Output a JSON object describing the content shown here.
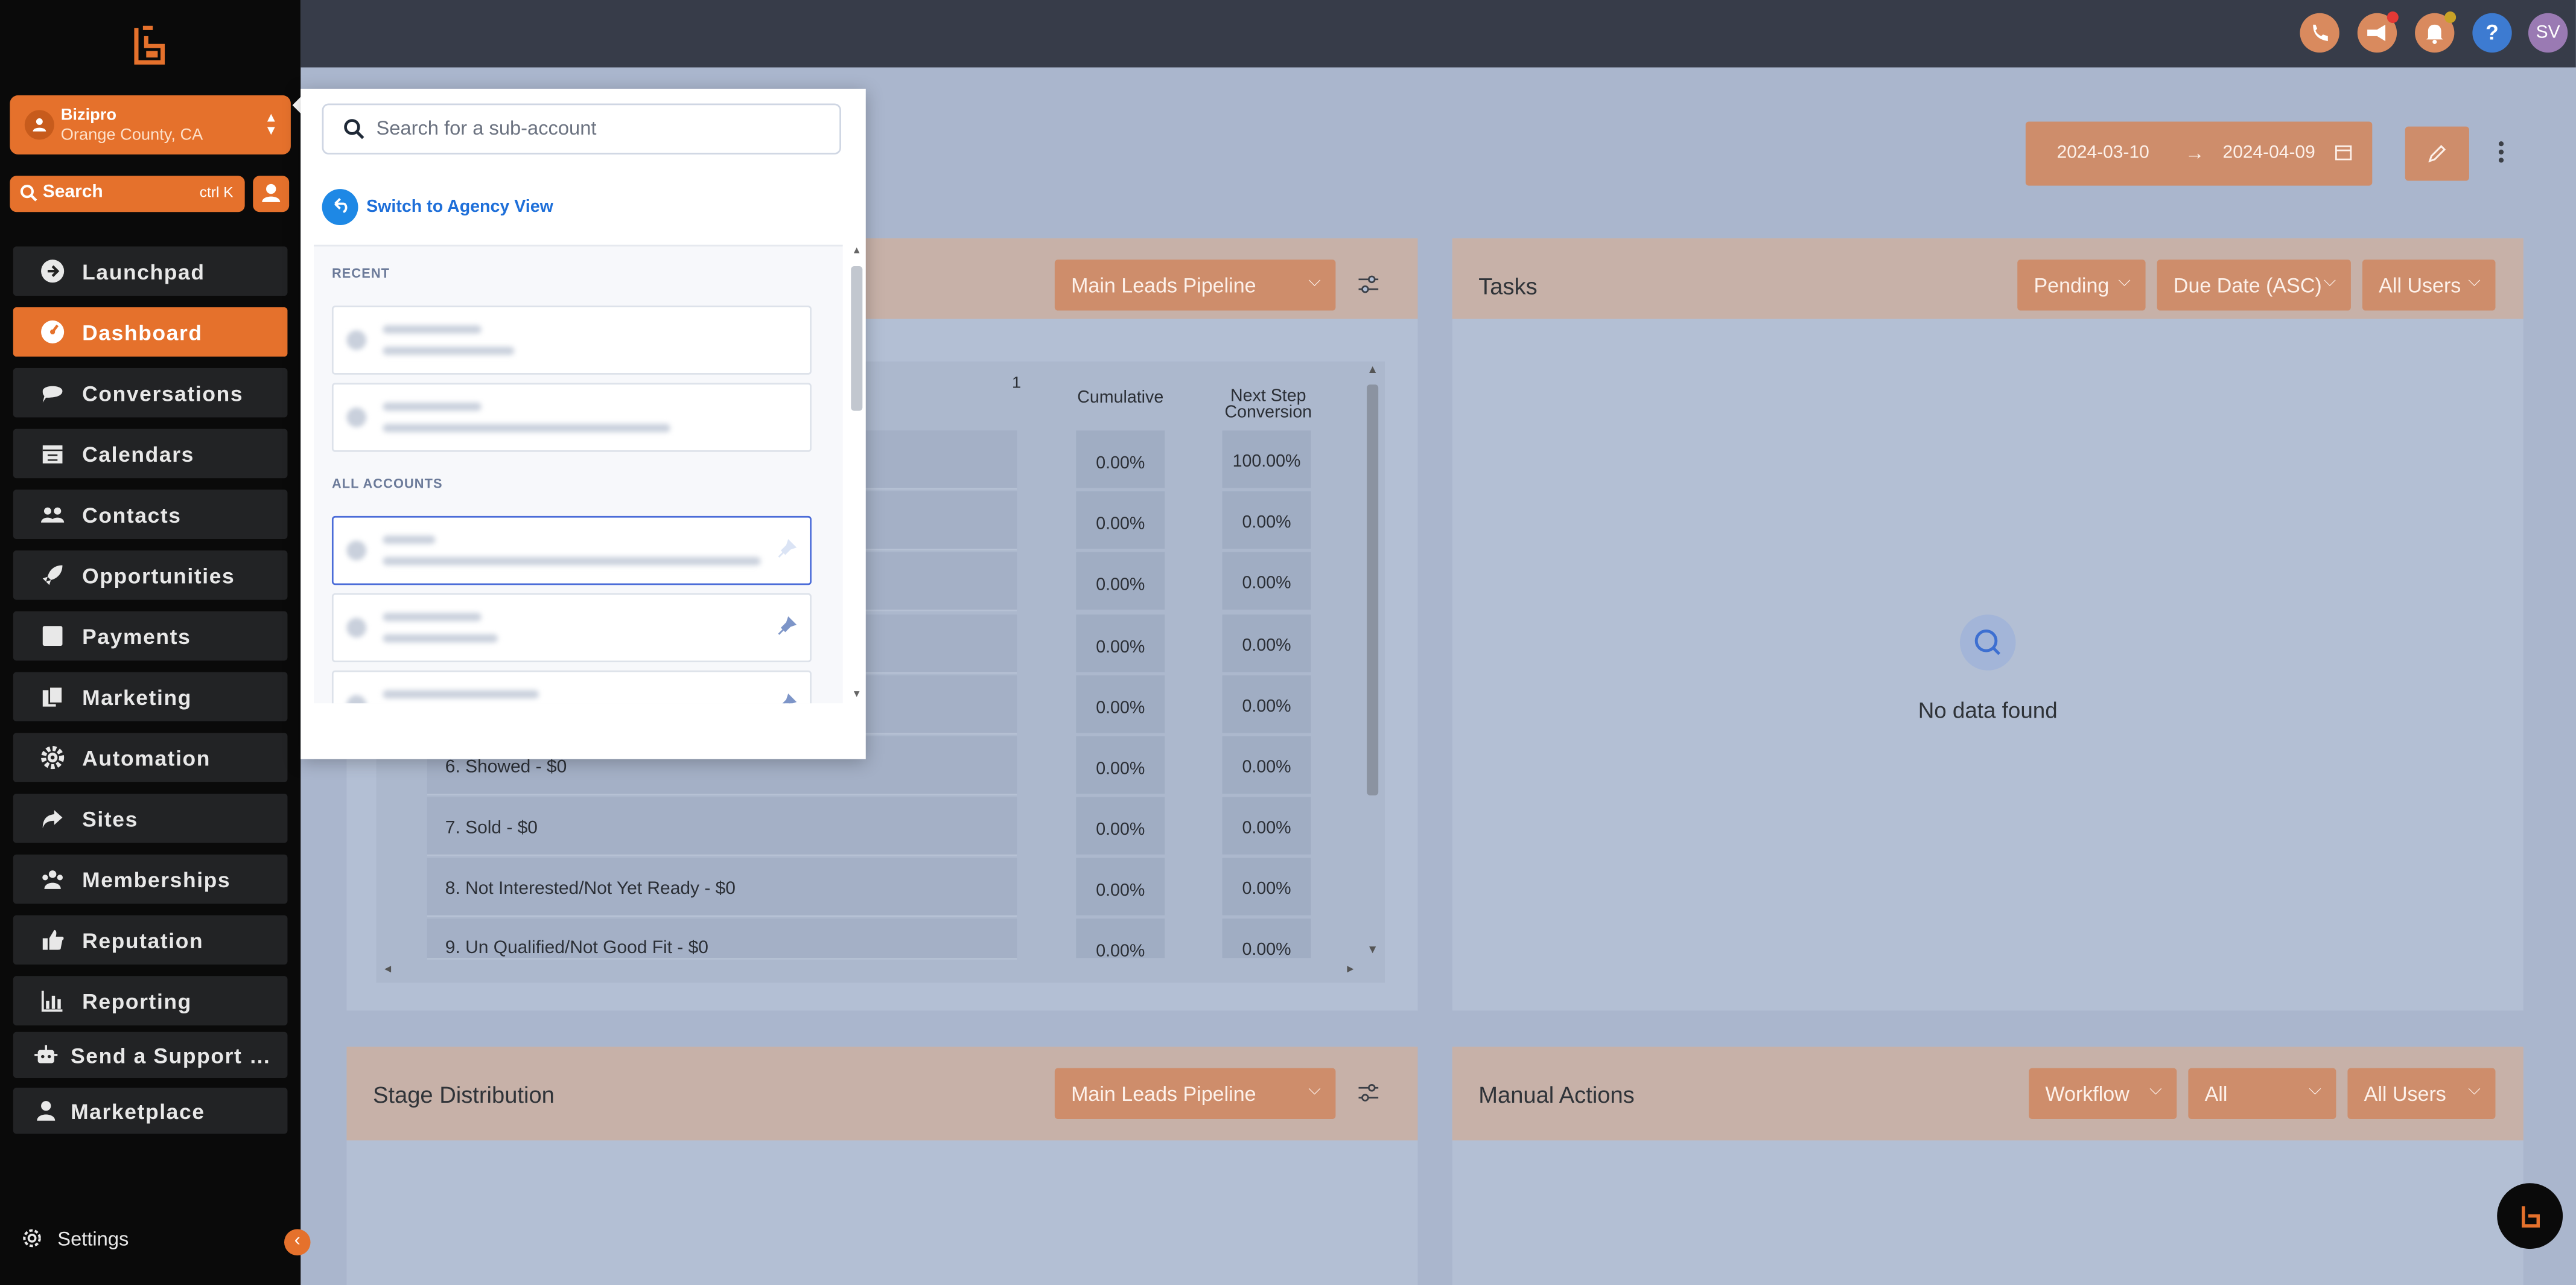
{
  "colors": {
    "accent": "#e5712c",
    "sidebar": "#0a0a0a",
    "topbar": "#373c49",
    "link_blue": "#1e6fd9"
  },
  "sidebar": {
    "account": {
      "name": "Bizipro",
      "location": "Orange County, CA"
    },
    "search": {
      "label": "Search",
      "shortcut": "ctrl K"
    },
    "items": [
      {
        "label": "Launchpad",
        "icon": "launchpad-icon"
      },
      {
        "label": "Dashboard",
        "icon": "dashboard-icon",
        "active": true
      },
      {
        "label": "Conversations",
        "icon": "chat-bubble-icon"
      },
      {
        "label": "Calendars",
        "icon": "calendar-icon"
      },
      {
        "label": "Contacts",
        "icon": "contacts-icon"
      },
      {
        "label": "Opportunities",
        "icon": "rocket-icon"
      },
      {
        "label": "Payments",
        "icon": "payments-icon"
      },
      {
        "label": "Marketing",
        "icon": "marketing-icon"
      },
      {
        "label": "Automation",
        "icon": "gear-icon"
      },
      {
        "label": "Sites",
        "icon": "share-arrow-icon"
      },
      {
        "label": "Memberships",
        "icon": "members-icon"
      },
      {
        "label": "Reputation",
        "icon": "thumbs-up-icon"
      },
      {
        "label": "Reporting",
        "icon": "bar-chart-icon"
      },
      {
        "label": "Send a Support …",
        "icon": "robot-icon"
      },
      {
        "label": "Marketplace",
        "icon": "person-icon"
      }
    ],
    "settings_label": "Settings",
    "collapse_glyph": "‹"
  },
  "topbar": {
    "avatar_initials": "SV",
    "help_glyph": "?"
  },
  "date_range": {
    "start": "2024-03-10",
    "end": "2024-04-09",
    "arrow": "→"
  },
  "leads_card": {
    "pipeline": "Main Leads Pipeline",
    "header_number": "1",
    "columns": {
      "cumulative": "Cumulative",
      "next_step_line1": "Next Step",
      "next_step_line2": "Conversion"
    },
    "rows": [
      {
        "stage": "",
        "cumulative": "0.00%",
        "next": "100.00%"
      },
      {
        "stage": "",
        "cumulative": "0.00%",
        "next": "0.00%"
      },
      {
        "stage": "",
        "cumulative": "0.00%",
        "next": "0.00%"
      },
      {
        "stage": "",
        "cumulative": "0.00%",
        "next": "0.00%"
      },
      {
        "stage": "",
        "cumulative": "0.00%",
        "next": "0.00%"
      },
      {
        "stage": "6. Showed - $0",
        "cumulative": "0.00%",
        "next": "0.00%"
      },
      {
        "stage": "7. Sold - $0",
        "cumulative": "0.00%",
        "next": "0.00%"
      },
      {
        "stage": "8. Not Interested/Not Yet Ready - $0",
        "cumulative": "0.00%",
        "next": "0.00%"
      },
      {
        "stage": "9. Un Qualified/Not Good Fit - $0",
        "cumulative": "0.00%",
        "next": "0.00%"
      }
    ]
  },
  "tasks_card": {
    "title": "Tasks",
    "status_filter": "Pending",
    "sort_filter": "Due Date (ASC)",
    "user_filter": "All Users",
    "empty_text": "No data found"
  },
  "stage_card": {
    "title": "Stage Distribution",
    "pipeline": "Main Leads Pipeline"
  },
  "manual_card": {
    "title": "Manual Actions",
    "workflow_filter": "Workflow",
    "all_filter": "All",
    "user_filter": "All Users"
  },
  "subaccount_panel": {
    "search_placeholder": "Search for a sub-account",
    "switch_label": "Switch to Agency View",
    "recent_label": "RECENT",
    "all_label": "ALL ACCOUNTS"
  }
}
